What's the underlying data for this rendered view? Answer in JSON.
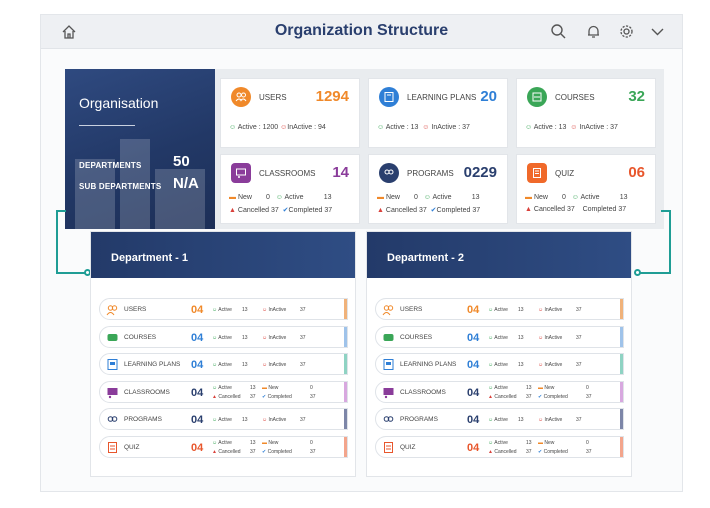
{
  "header": {
    "title": "Organization Structure"
  },
  "org": {
    "name": "Organisation",
    "departments_label": "DEPARTMENTS",
    "departments_value": "50",
    "sub_departments_label": "SUB DEPARTMENTS",
    "sub_departments_value": "N/A"
  },
  "cards": {
    "users": {
      "label": "USERS",
      "value": "1294",
      "active": "Active : 1200",
      "inactive": "InActive : 94"
    },
    "learning_plans": {
      "label": "LEARNING PLANS",
      "value": "20",
      "active": "Active : 13",
      "inactive": "InActive : 37"
    },
    "courses": {
      "label": "COURSES",
      "value": "32",
      "active": "Active : 13",
      "inactive": "InActive : 37"
    },
    "classrooms": {
      "label": "CLASSROOMS",
      "value": "14",
      "new": "New",
      "new_v": "0",
      "active": "Active",
      "active_v": "13",
      "cancelled": "Cancelled",
      "cancelled_v": "37",
      "completed": "Completed",
      "completed_v": "37"
    },
    "programs": {
      "label": "PROGRAMS",
      "value": "0229",
      "new": "New",
      "new_v": "0",
      "active": "Active",
      "active_v": "13",
      "cancelled": "Cancelled",
      "cancelled_v": "37",
      "completed": "Completed",
      "completed_v": "37"
    },
    "quiz": {
      "label": "QUIZ",
      "value": "06",
      "new": "New",
      "new_v": "0",
      "active": "Active",
      "active_v": "13",
      "cancelled": "Cancelled",
      "cancelled_v": "37",
      "completed": "Completed",
      "completed_v": "37"
    }
  },
  "departments": [
    {
      "title": "Department - 1"
    },
    {
      "title": "Department - 2"
    }
  ],
  "dept_rows": {
    "users": {
      "label": "USERS",
      "value": "04",
      "a": "Active",
      "av": "13",
      "b": "InActive",
      "bv": "37"
    },
    "courses": {
      "label": "COURSES",
      "value": "04",
      "a": "Active",
      "av": "13",
      "b": "InActive",
      "bv": "37"
    },
    "learning_plans": {
      "label": "LEARNING PLANS",
      "value": "04",
      "a": "Active",
      "av": "13",
      "b": "InActive",
      "bv": "37"
    },
    "classrooms": {
      "label": "CLASSROOMS",
      "value": "04",
      "a": "Active",
      "av": "13",
      "n": "New",
      "nv": "0",
      "c": "Cancelled",
      "cv": "37",
      "d": "Completed",
      "dv": "37"
    },
    "programs": {
      "label": "PROGRAMS",
      "value": "04",
      "a": "Active",
      "av": "13",
      "b": "InActive",
      "bv": "37"
    },
    "quiz": {
      "label": "QUIZ",
      "value": "04",
      "a": "Active",
      "av": "13",
      "n": "New",
      "nv": "0",
      "c": "Cancelled",
      "cv": "37",
      "d": "Completed",
      "dv": "37"
    }
  },
  "colors": {
    "navy": "#2a3f6e",
    "orange": "#f0892a",
    "blue": "#2f7fd6",
    "green": "#3aa657",
    "purple": "#8a3c9a",
    "teal": "#1f9d95",
    "red": "#d9413b"
  },
  "icons": [
    "home-icon",
    "search-icon",
    "bell-icon",
    "gear-icon",
    "chevron-down-icon"
  ]
}
